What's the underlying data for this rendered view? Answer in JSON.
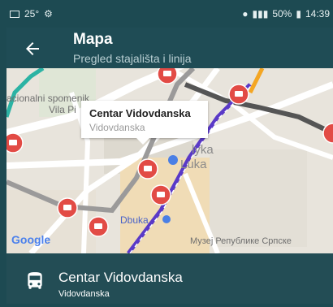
{
  "status_bar": {
    "left_text": "25°",
    "battery": "50%",
    "time": "14:39"
  },
  "header": {
    "title": "Mapa",
    "subtitle": "Pregled stajališta i linija",
    "back_icon": "arrow-left-icon"
  },
  "map": {
    "labels": {
      "monument": "acionalni spomenik",
      "vila": "Vila Pi",
      "area_1": "lyka",
      "area_2": "Luka",
      "tram": "Dbuka",
      "museum": "Музеј Републике Српске",
      "google": "Google"
    },
    "callout": {
      "title": "Centar Vidovdanska",
      "subtitle": "Vidovdanska"
    },
    "stop_icon": "bus-stop-marker-icon"
  },
  "selected_stop": {
    "name": "Centar Vidovdanska",
    "street": "Vidovdanska",
    "icon": "bus-icon"
  },
  "colors": {
    "header_bg": "#1f4c55",
    "stop_marker": "#e24b45",
    "route_purple": "#5a39c7",
    "route_teal": "#2bb3a4",
    "route_orange": "#f4a623"
  }
}
